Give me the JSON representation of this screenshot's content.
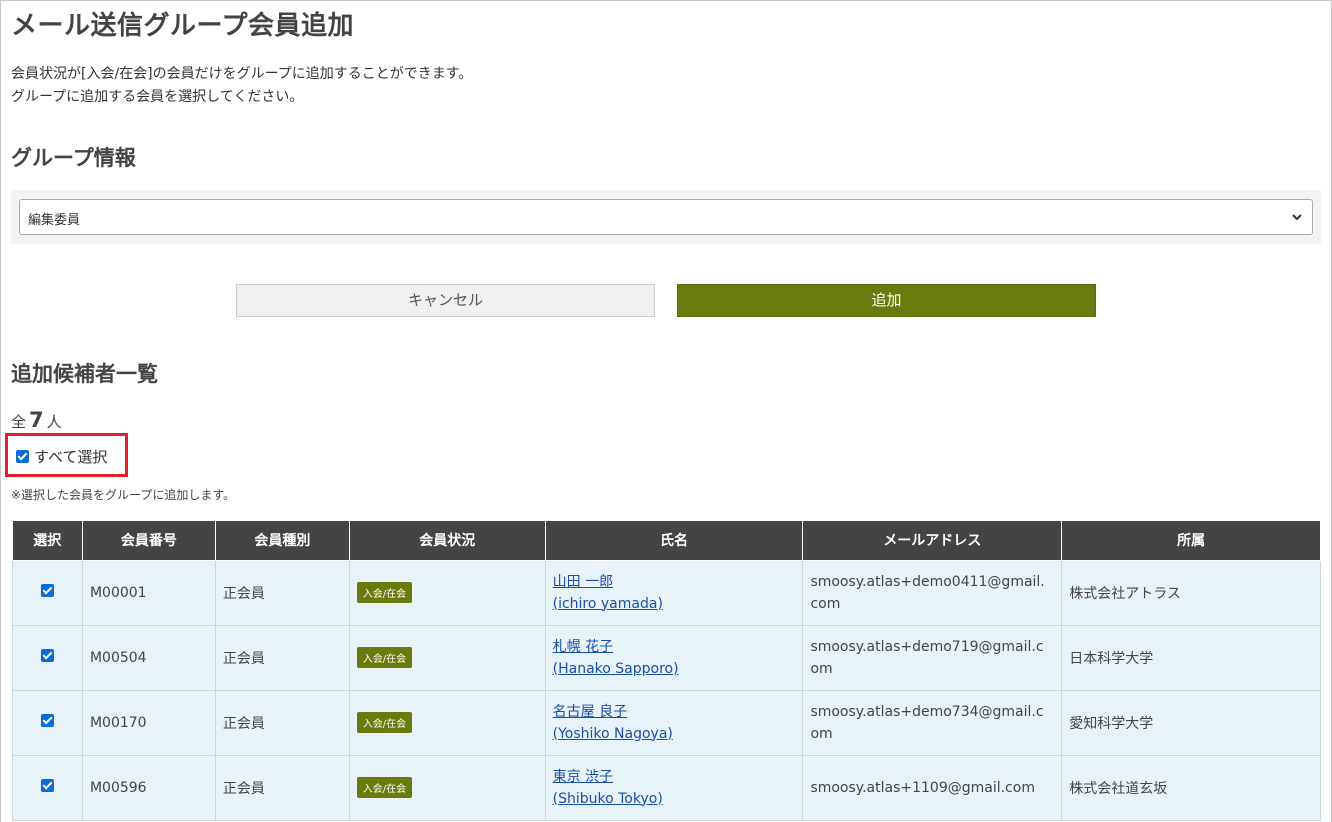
{
  "page": {
    "title": "メール送信グループ会員追加",
    "description_line1": "会員状況が[入会/在会]の会員だけをグループに追加することができます。",
    "description_line2": "グループに追加する会員を選択してください。"
  },
  "group_section": {
    "title": "グループ情報",
    "selected_group": "編集委員"
  },
  "buttons": {
    "cancel_label": "キャンセル",
    "add_label": "追加"
  },
  "candidates": {
    "title": "追加候補者一覧",
    "total_prefix": "全",
    "total_count": "7",
    "total_suffix": "人",
    "select_all_label": "すべて選択",
    "select_all_checked": true,
    "note": "※選択した会員をグループに追加します。"
  },
  "table": {
    "headers": [
      "選択",
      "会員番号",
      "会員種別",
      "会員状況",
      "氏名",
      "メールアドレス",
      "所属"
    ],
    "rows": [
      {
        "checked": true,
        "number": "M00001",
        "type": "正会員",
        "status": "入会/在会",
        "name": "山田 一郎",
        "name_roman": "(ichiro yamada)",
        "email_line1": "smoosy.atlas+demo0411@gmail.",
        "email_line2": "com",
        "affiliation": "株式会社アトラス"
      },
      {
        "checked": true,
        "number": "M00504",
        "type": "正会員",
        "status": "入会/在会",
        "name": "札幌 花子",
        "name_roman": "(Hanako Sapporo)",
        "email_line1": "smoosy.atlas+demo719@gmail.c",
        "email_line2": "om",
        "affiliation": "日本科学大学"
      },
      {
        "checked": true,
        "number": "M00170",
        "type": "正会員",
        "status": "入会/在会",
        "name": "名古屋 良子",
        "name_roman": "(Yoshiko Nagoya)",
        "email_line1": "smoosy.atlas+demo734@gmail.c",
        "email_line2": "om",
        "affiliation": "愛知科学大学"
      },
      {
        "checked": true,
        "number": "M00596",
        "type": "正会員",
        "status": "入会/在会",
        "name": "東京 渋子",
        "name_roman": "(Shibuko Tokyo)",
        "email_line1": "smoosy.atlas+1109@gmail.com",
        "email_line2": "",
        "affiliation": "株式会社道玄坂"
      }
    ]
  },
  "colors": {
    "accent": "#6b7a0c",
    "header_bg": "#444444",
    "row_bg": "#e8f2f9",
    "highlight_border": "#e0202a",
    "link": "#1a4ea8"
  }
}
